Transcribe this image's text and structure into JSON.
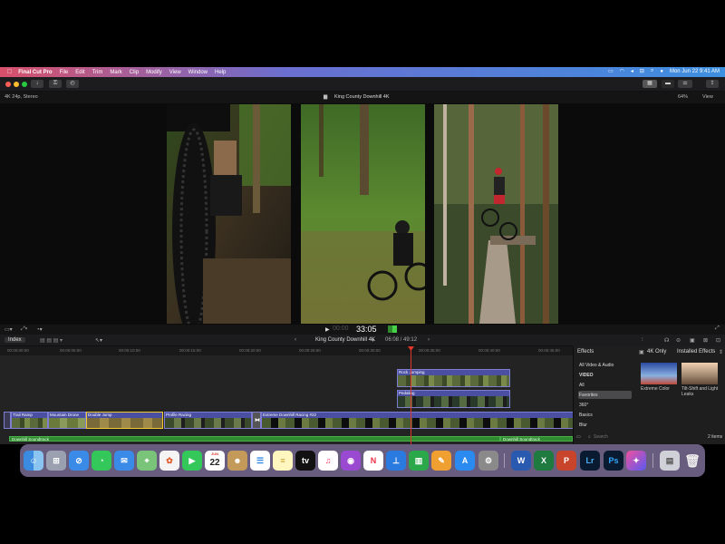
{
  "menubar": {
    "app_name": "Final Cut Pro",
    "items": [
      "File",
      "Edit",
      "Trim",
      "Mark",
      "Clip",
      "Modify",
      "View",
      "Window",
      "Help"
    ],
    "datetime": "Mon Jun 22  9:41 AM"
  },
  "viewer": {
    "format": "4K 24p, Stereo",
    "project_title": "King County Downhill 4K",
    "zoom": "64%",
    "view_label": "View",
    "timecode": "33:05"
  },
  "timeline": {
    "index_label": "Index",
    "project_title": "King County Downhill 4K",
    "duration": "06:08 / 49:12",
    "ruler_ticks": [
      "00:00:00:00",
      "00:00:05:00",
      "00:00:10:00",
      "00:00:15:00",
      "00:00:20:00",
      "00:00:25:00",
      "00:00:30:00",
      "00:00:35:00",
      "00:00:40:00",
      "00:00:45:00"
    ],
    "connected_clips": [
      {
        "label": "Rock Jumping"
      },
      {
        "label": "Pedaling"
      }
    ],
    "primary_clips": [
      {
        "label": "Trail Ramp"
      },
      {
        "label": "Mountain Drone"
      },
      {
        "label": "Double Jump"
      },
      {
        "label": "Profile Racing"
      },
      {
        "label": "Extreme Downhill Racing #22"
      }
    ],
    "audio_clips": [
      {
        "label": "Downhill Soundtrack"
      },
      {
        "label": "Downhill Soundtrack"
      }
    ]
  },
  "effects": {
    "title": "Effects",
    "filter_4k": "4K Only",
    "installed": "Installed Effects",
    "categories": [
      "All Video & Audio",
      "VIDEO",
      "All",
      "Favorites",
      "360°",
      "Basics",
      "Blur"
    ],
    "selected_category": "Favorites",
    "items": [
      {
        "name": "Extreme Color"
      },
      {
        "name": "Tilt-Shift and Light Leaks"
      }
    ],
    "search_placeholder": "Search",
    "count": "2 items"
  },
  "dock": {
    "apps": [
      "Finder",
      "Launchpad",
      "Safari",
      "Messages",
      "Mail",
      "Maps",
      "Photos",
      "FaceTime",
      "Calendar",
      "Contacts",
      "Reminders",
      "Notes",
      "TV",
      "Music",
      "Podcasts",
      "News",
      "Keynote",
      "Numbers",
      "Pages",
      "App Store",
      "System Preferences",
      "Word",
      "Excel",
      "PowerPoint",
      "Lightroom",
      "Photoshop",
      "Final Cut Pro",
      "Preview",
      "Trash"
    ],
    "calendar_day": "22",
    "calendar_month": "JUN"
  },
  "colors": {
    "accent": "#4a4fa2",
    "audio": "#2f8a2f",
    "playhead": "#e0362b"
  }
}
